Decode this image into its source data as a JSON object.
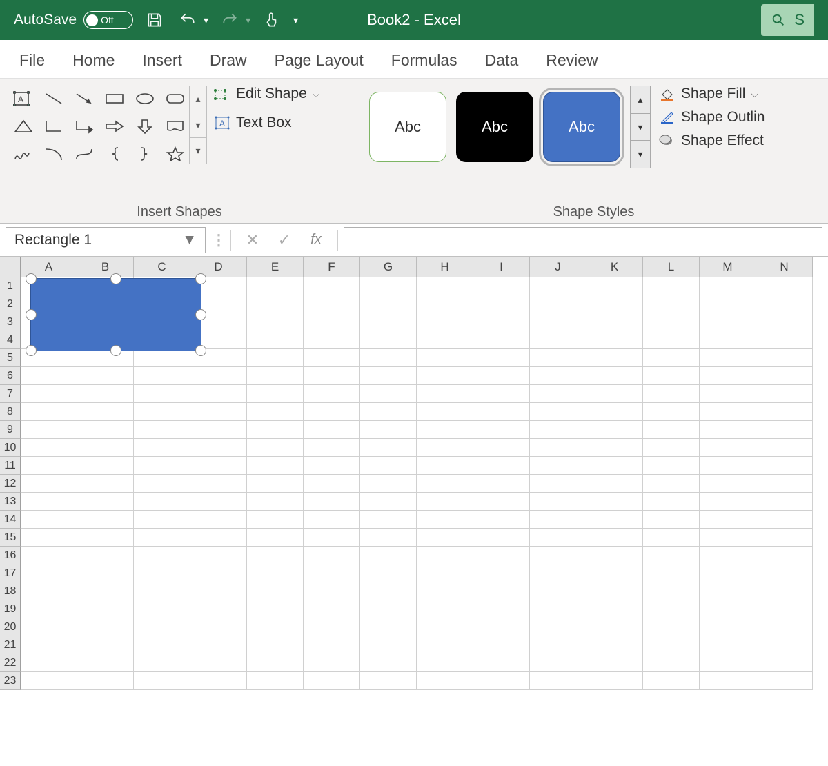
{
  "titlebar": {
    "autosave_label": "AutoSave",
    "autosave_state": "Off",
    "document_title": "Book2  -  Excel",
    "search_placeholder": "S"
  },
  "tabs": [
    "File",
    "Home",
    "Insert",
    "Draw",
    "Page Layout",
    "Formulas",
    "Data",
    "Review"
  ],
  "ribbon": {
    "insert_shapes": {
      "label": "Insert Shapes",
      "edit_shape": "Edit Shape",
      "text_box": "Text Box"
    },
    "shape_styles": {
      "label": "Shape Styles",
      "preview_text": "Abc",
      "fill": "Shape Fill",
      "outline": "Shape Outlin",
      "effects": "Shape Effect"
    }
  },
  "formula_bar": {
    "name_box": "Rectangle 1",
    "fx_label": "fx",
    "formula": ""
  },
  "grid": {
    "columns": [
      "A",
      "B",
      "C",
      "D",
      "E",
      "F",
      "G",
      "H",
      "I",
      "J",
      "K",
      "L",
      "M",
      "N"
    ],
    "rows": [
      "1",
      "2",
      "3",
      "4",
      "5",
      "6",
      "7",
      "8",
      "9",
      "10",
      "11",
      "12",
      "13",
      "14",
      "15",
      "16",
      "17",
      "18",
      "19",
      "20",
      "21",
      "22",
      "23"
    ]
  },
  "selected_shape": {
    "name": "Rectangle 1",
    "fill": "#4472c4"
  }
}
